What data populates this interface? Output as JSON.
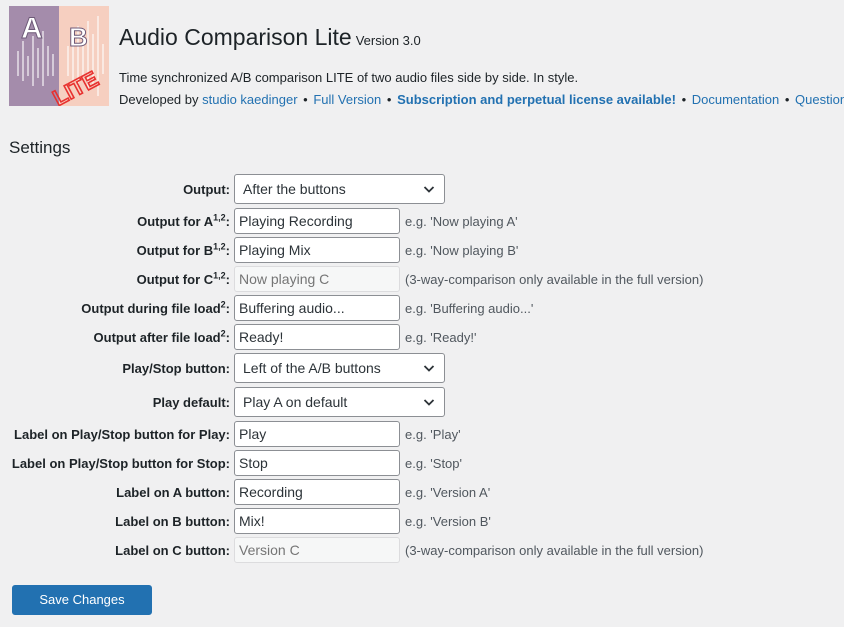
{
  "plugin": {
    "title": "Audio Comparison Lite",
    "version": "Version 3.0",
    "description": "Time synchronized A/B comparison LITE of two audio files side by side. In style.",
    "developed_by": "Developed by",
    "links": {
      "studio": "studio kaedinger",
      "full": "Full Version",
      "subscription": "Subscription and perpetual license available!",
      "docs": "Documentation",
      "questions": "Questions?"
    },
    "separator": "•"
  },
  "logo": {
    "letter_a": "A",
    "letter_b": "B",
    "stamp": "LITE"
  },
  "settings": {
    "heading": "Settings",
    "rows": [
      {
        "label": "Output",
        "sup": "",
        "kind": "select",
        "value": "After the buttons",
        "hint": ""
      },
      {
        "label": "Output for A",
        "sup": "1,2",
        "kind": "input",
        "value": "Playing Recording",
        "hint": "e.g. 'Now playing A'"
      },
      {
        "label": "Output for B",
        "sup": "1,2",
        "kind": "input",
        "value": "Playing Mix",
        "hint": "e.g. 'Now playing B'"
      },
      {
        "label": "Output for C",
        "sup": "1,2",
        "kind": "disabled",
        "placeholder": "Now playing C",
        "hint": "(3-way-comparison only available in the full version)"
      },
      {
        "label": "Output during file load",
        "sup": "2",
        "kind": "input",
        "value": "Buffering audio...",
        "hint": "e.g. 'Buffering audio...'"
      },
      {
        "label": "Output after file load",
        "sup": "2",
        "kind": "input",
        "value": "Ready!",
        "hint": "e.g. 'Ready!'"
      },
      {
        "label": "Play/Stop button",
        "sup": "",
        "kind": "select",
        "value": "Left of the A/B buttons",
        "hint": ""
      },
      {
        "label": "Play default",
        "sup": "",
        "kind": "select",
        "value": "Play A on default",
        "hint": ""
      },
      {
        "label": "Label on Play/Stop button for Play",
        "sup": "",
        "kind": "input",
        "value": "Play",
        "hint": "e.g. 'Play'"
      },
      {
        "label": "Label on Play/Stop button for Stop",
        "sup": "",
        "kind": "input",
        "value": "Stop",
        "hint": "e.g. 'Stop'"
      },
      {
        "label": "Label on A button",
        "sup": "",
        "kind": "input",
        "value": "Recording",
        "hint": "e.g. 'Version A'"
      },
      {
        "label": "Label on B button",
        "sup": "",
        "kind": "input",
        "value": "Mix!",
        "hint": "e.g. 'Version B'"
      },
      {
        "label": "Label on C button",
        "sup": "",
        "kind": "disabled",
        "placeholder": "Version C",
        "hint": "(3-way-comparison only available in the full version)"
      }
    ],
    "colon": ":"
  },
  "save_label": "Save Changes",
  "colors": {
    "accent": "#2271b1",
    "background": "#f0f0f1",
    "logo_stamp": "#e8312f"
  }
}
